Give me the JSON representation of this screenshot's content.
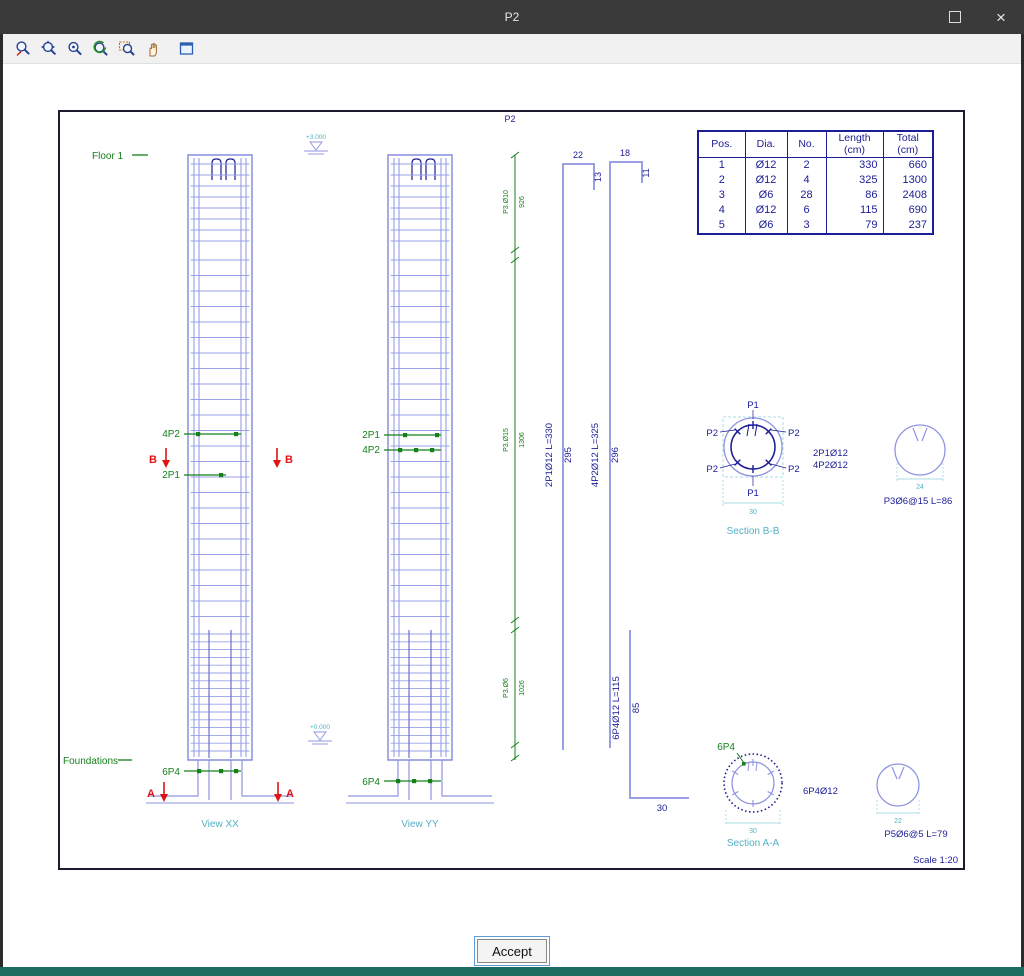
{
  "window": {
    "title": "P2",
    "close_glyph": "×"
  },
  "toolbar": {
    "icons": [
      "zoom-dynamic",
      "zoom-extents",
      "zoom-observer",
      "zoom-refresh",
      "zoom-window",
      "pan",
      "preview"
    ]
  },
  "footer": {
    "accept_label": "Accept"
  },
  "drawing": {
    "sheet_title": "P2",
    "scale_note": "Scale 1:20",
    "floor_label": "Floor 1",
    "foundations_label": "Foundations",
    "view_xx_label": "View XX",
    "view_yy_label": "View YY",
    "datum_top": "+3.000",
    "datum_bottom": "+0.000",
    "markers": {
      "xx_top1": "4P2",
      "xx_top2": "2P1",
      "xx_bottom": "6P4",
      "yy_top1": "2P1",
      "yy_top2": "4P2",
      "yy_bottom": "6P4",
      "section_b_letter": "B",
      "section_a_letter": "A"
    },
    "bars": {
      "bar1": {
        "label": "2P1Ø12 L=330",
        "len": "295",
        "top": "22",
        "hook": "13"
      },
      "bar2": {
        "label": "4P2Ø12 L=325",
        "len": "296",
        "top": "18",
        "hook": "11"
      },
      "bar3": {
        "label": "6P4Ø12 L=115",
        "len": "85",
        "bottom": "30"
      }
    },
    "dim_chain": [
      {
        "label": "P3.Ø10",
        "value": "926"
      },
      {
        "label": "P3.Ø15",
        "value": "1306"
      },
      {
        "label": "P3.Ø6",
        "value": "1026"
      }
    ],
    "section_b": {
      "title": "Section B-B",
      "p1": "P1",
      "p2": "P2",
      "note_line1": "2P1Ø12",
      "note_line2": "4P2Ø12",
      "dim": "30"
    },
    "stirrup_b": {
      "label": "P3Ø6@15 L=86",
      "dim": "24"
    },
    "section_a": {
      "title": "Section A-A",
      "tag": "6P4",
      "note": "6P4Ø12",
      "dim": "30"
    },
    "stirrup_a": {
      "label": "P5Ø6@5 L=79",
      "dim": "22"
    },
    "table": {
      "headers": [
        "Pos.",
        "Dia.",
        "No.",
        "Length\n(cm)",
        "Total\n(cm)"
      ],
      "rows": [
        [
          "1",
          "Ø12",
          "2",
          "330",
          "660"
        ],
        [
          "2",
          "Ø12",
          "4",
          "325",
          "1300"
        ],
        [
          "3",
          "Ø6",
          "28",
          "86",
          "2408"
        ],
        [
          "4",
          "Ø12",
          "6",
          "115",
          "690"
        ],
        [
          "5",
          "Ø6",
          "3",
          "79",
          "237"
        ]
      ]
    }
  }
}
